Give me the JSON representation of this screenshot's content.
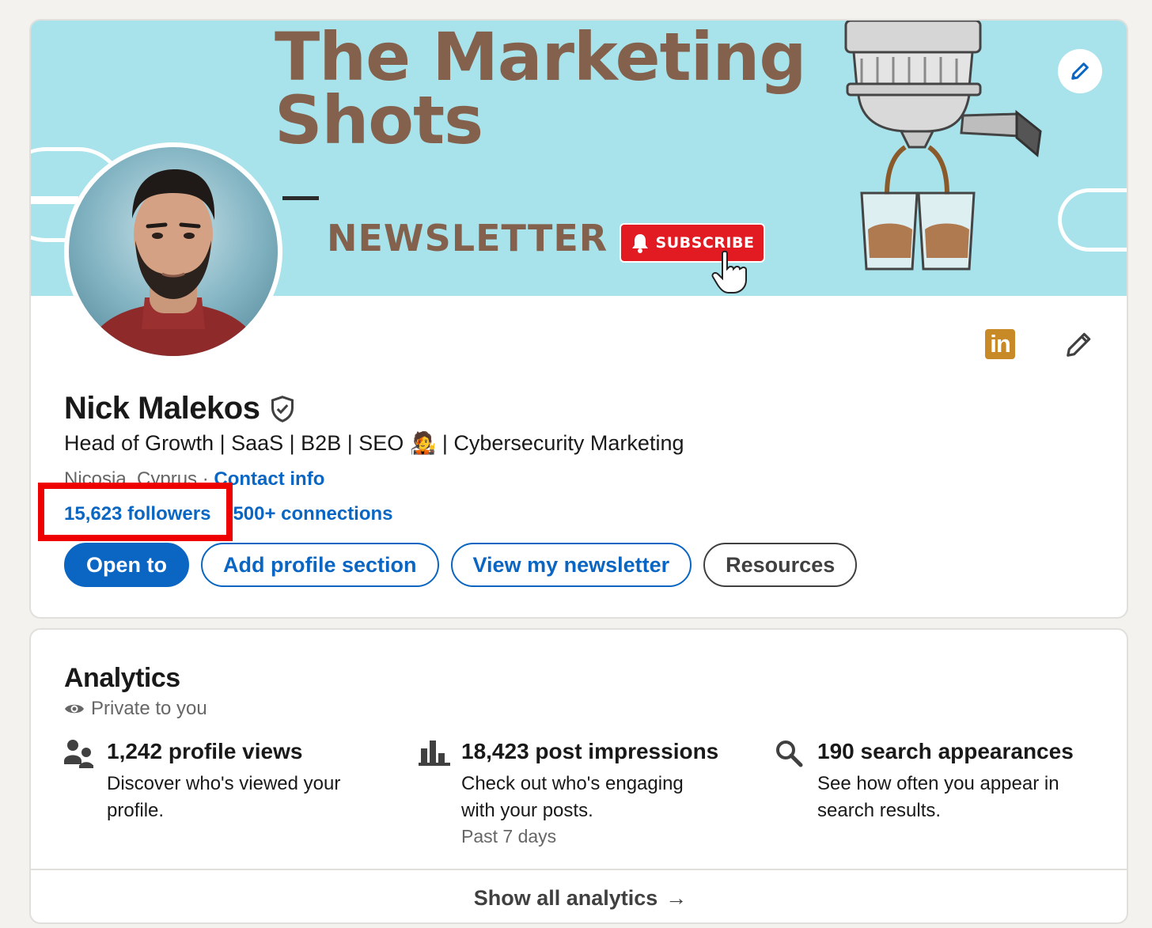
{
  "banner": {
    "title_line1": "The Marketing",
    "title_line2": "Shots",
    "dash": "—",
    "newsletter": "NEWSLETTER",
    "subscribe": "SUBSCRIBE"
  },
  "profile": {
    "name": "Nick Malekos",
    "headline": "Head of Growth | SaaS | B2B | SEO 🧑‍🎤 | Cybersecurity Marketing",
    "location": "Nicosia, Cyprus",
    "separator": " · ",
    "contact_info": "Contact info",
    "followers": "15,623 followers",
    "connections": "500+ connections",
    "linkedin_logo": "in"
  },
  "actions": {
    "open_to": "Open to",
    "add_profile_section": "Add profile section",
    "view_newsletter": "View my newsletter",
    "resources": "Resources"
  },
  "analytics": {
    "title": "Analytics",
    "private_label": "Private to you",
    "items": [
      {
        "metric": "1,242 profile views",
        "description": "Discover who's viewed your profile.",
        "icon": "people-icon"
      },
      {
        "metric": "18,423 post impressions",
        "description": "Check out who's engaging with your posts.",
        "period": "Past 7 days",
        "icon": "bar-chart-icon"
      },
      {
        "metric": "190 search appearances",
        "description": "See how often you appear in search results.",
        "icon": "search-icon"
      }
    ],
    "show_all": "Show all analytics",
    "arrow": "→"
  },
  "colors": {
    "linkedin_blue": "#0a66c2",
    "banner_bg": "#a8e2ea",
    "banner_text": "#84614c",
    "subscribe_red": "#e21b23",
    "highlight_red": "#ee0000"
  }
}
